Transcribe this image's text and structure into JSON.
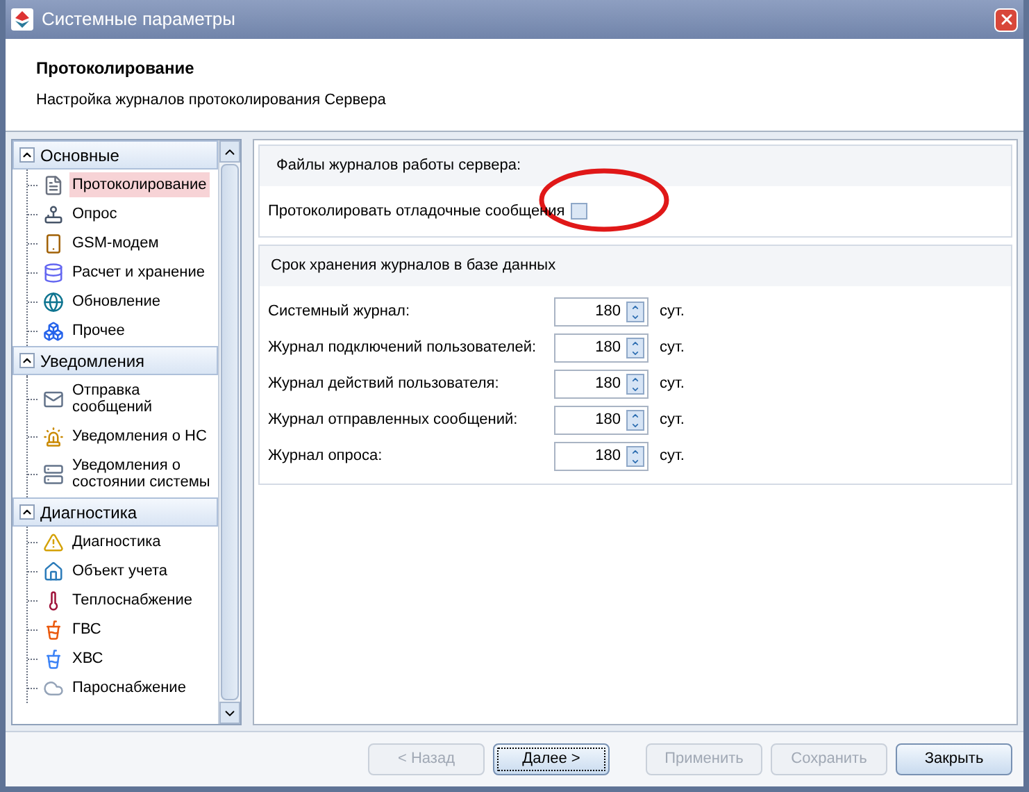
{
  "window": {
    "title": "Системные параметры"
  },
  "header": {
    "title": "Протоколирование",
    "subtitle": "Настройка журналов протоколирования Сервера"
  },
  "sidebar": {
    "groups": [
      {
        "label": "Основные",
        "expanded": true,
        "children": [
          {
            "label": "Протоколирование",
            "kind": "document",
            "selected": true
          },
          {
            "label": "Опрос",
            "kind": "joystick",
            "selected": false
          },
          {
            "label": "GSM-модем",
            "kind": "phone",
            "selected": false
          },
          {
            "label": "Расчет и хранение",
            "kind": "database",
            "selected": false
          },
          {
            "label": "Обновление",
            "kind": "globe",
            "selected": false
          },
          {
            "label": "Прочее",
            "kind": "blocks",
            "selected": false
          }
        ]
      },
      {
        "label": "Уведомления",
        "expanded": true,
        "children": [
          {
            "label": "Отправка сообщений",
            "kind": "mail",
            "selected": false
          },
          {
            "label": "Уведомления о НС",
            "kind": "alarm",
            "selected": false
          },
          {
            "label": "Уведомления о состоянии системы",
            "kind": "server",
            "selected": false
          }
        ]
      },
      {
        "label": "Диагностика",
        "expanded": true,
        "children": [
          {
            "label": "Диагностика",
            "kind": "warning",
            "selected": false
          },
          {
            "label": "Объект учета",
            "kind": "house",
            "selected": false
          },
          {
            "label": "Теплоснабжение",
            "kind": "thermometer",
            "selected": false
          },
          {
            "label": "ГВС",
            "kind": "hotcup",
            "selected": false
          },
          {
            "label": "ХВС",
            "kind": "coldcup",
            "selected": false
          },
          {
            "label": "Пароснабжение",
            "kind": "cloud",
            "selected": false
          }
        ]
      }
    ]
  },
  "log_files": {
    "title": "Файлы журналов работы сервера:",
    "debug_option": {
      "label": "Протоколировать отладочные сообщения",
      "checked": false
    }
  },
  "retention": {
    "title": "Срок хранения журналов в базе данных",
    "rows": [
      {
        "label": "Системный журнал:",
        "value": "180",
        "unit": "сут."
      },
      {
        "label": "Журнал подключений пользователей:",
        "value": "180",
        "unit": "сут."
      },
      {
        "label": "Журнал действий пользователя:",
        "value": "180",
        "unit": "сут."
      },
      {
        "label": "Журнал отправленных сообщений:",
        "value": "180",
        "unit": "сут."
      },
      {
        "label": "Журнал опроса:",
        "value": "180",
        "unit": "сут."
      }
    ]
  },
  "buttons": [
    {
      "label": "< Назад",
      "disabled": true,
      "focused": false
    },
    {
      "label": "Далее >",
      "disabled": false,
      "focused": true
    },
    {
      "label": "Применить",
      "disabled": true,
      "focused": false
    },
    {
      "label": "Сохранить",
      "disabled": true,
      "focused": false
    },
    {
      "label": "Закрыть",
      "disabled": false,
      "focused": false
    }
  ]
}
